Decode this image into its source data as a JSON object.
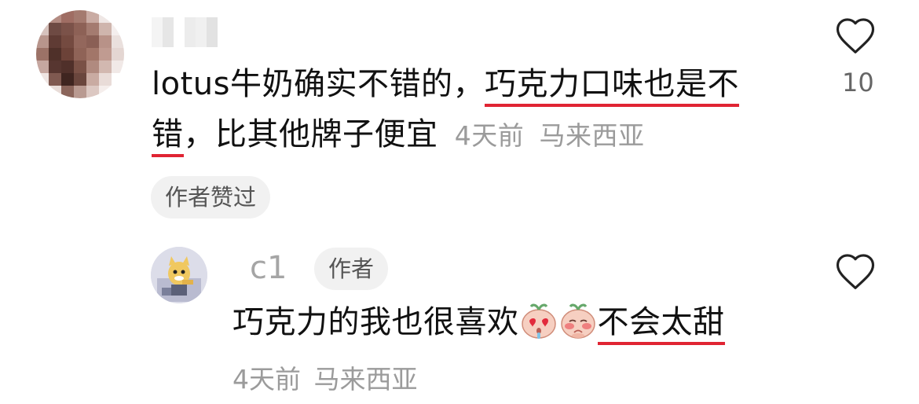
{
  "comment": {
    "text_plain_1": "lotus牛奶确实不错的，",
    "text_underlined_1": "巧克力口味也是不",
    "text_underlined_2": "错",
    "text_plain_2": "，比其他牌子便宜",
    "time": "4天前",
    "location": "马来西亚",
    "author_liked_badge": "作者赞过",
    "like_count": "10"
  },
  "reply": {
    "username": "c1",
    "author_badge": "作者",
    "text_plain": "巧克力的我也很喜欢",
    "emojis": [
      "smitten-peach-emoji",
      "shy-peach-emoji"
    ],
    "text_underlined": "不会太甜",
    "time": "4天前",
    "location": "马来西亚"
  },
  "colors": {
    "underline": "#e02433",
    "meta_text": "#9b9b9b",
    "pill_bg": "#f1f1f1"
  }
}
